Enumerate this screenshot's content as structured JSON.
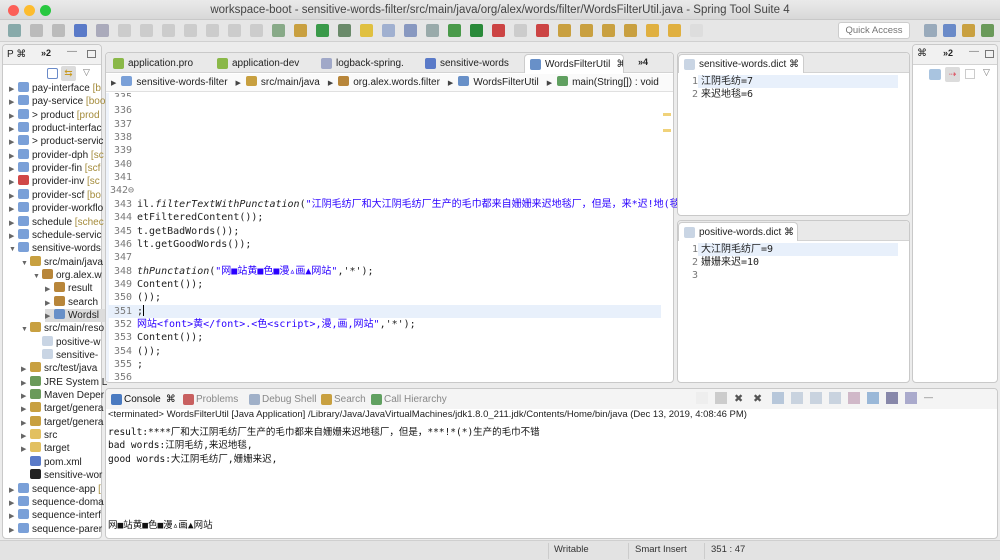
{
  "window": {
    "title": "workspace-boot - sensitive-words-filter/src/main/java/org/alex/words/filter/WordsFilterUtil.java - Spring Tool Suite 4"
  },
  "toolbar": {
    "quick_access_placeholder": "Quick Access"
  },
  "explorer": {
    "tab_label": "P",
    "overflow_label": "»2",
    "items": [
      {
        "label": "pay-interface",
        "deco": " [b",
        "indent": 0,
        "arrow": "▶",
        "icon": "project"
      },
      {
        "label": "pay-service",
        "deco": " [boo",
        "indent": 0,
        "arrow": "▶",
        "icon": "project"
      },
      {
        "label": "> product",
        "deco": " [prod",
        "indent": 0,
        "arrow": "▶",
        "icon": "project"
      },
      {
        "label": "product-interfac",
        "deco": "",
        "indent": 0,
        "arrow": "▶",
        "icon": "project"
      },
      {
        "label": "> product-servic",
        "deco": "",
        "indent": 0,
        "arrow": "▶",
        "icon": "project"
      },
      {
        "label": "provider-dph",
        "deco": " [sc",
        "indent": 0,
        "arrow": "▶",
        "icon": "project"
      },
      {
        "label": "provider-fin",
        "deco": " [scf",
        "indent": 0,
        "arrow": "▶",
        "icon": "project"
      },
      {
        "label": "provider-inv",
        "deco": " [sc",
        "indent": 0,
        "arrow": "▶",
        "icon": "project-error"
      },
      {
        "label": "provider-scf",
        "deco": " [bo",
        "indent": 0,
        "arrow": "▶",
        "icon": "project"
      },
      {
        "label": "provider-workflo",
        "deco": "",
        "indent": 0,
        "arrow": "▶",
        "icon": "project"
      },
      {
        "label": "schedule",
        "deco": " [schec",
        "indent": 0,
        "arrow": "▶",
        "icon": "project"
      },
      {
        "label": "schedule-servic",
        "deco": "",
        "indent": 0,
        "arrow": "▶",
        "icon": "project"
      },
      {
        "label": "sensitive-words",
        "deco": "",
        "indent": 0,
        "arrow": "▼",
        "icon": "project"
      },
      {
        "label": "src/main/java",
        "deco": "",
        "indent": 1,
        "arrow": "▼",
        "icon": "source-folder"
      },
      {
        "label": "org.alex.w",
        "deco": "",
        "indent": 2,
        "arrow": "▼",
        "icon": "package"
      },
      {
        "label": "result",
        "deco": "",
        "indent": 3,
        "arrow": "▶",
        "icon": "package"
      },
      {
        "label": "search",
        "deco": "",
        "indent": 3,
        "arrow": "▶",
        "icon": "package"
      },
      {
        "label": "Wordsl",
        "deco": "",
        "indent": 3,
        "arrow": "▶",
        "icon": "java-file",
        "selected": true
      },
      {
        "label": "src/main/reso",
        "deco": "",
        "indent": 1,
        "arrow": "▼",
        "icon": "source-folder"
      },
      {
        "label": "positive-w",
        "deco": "",
        "indent": 2,
        "arrow": "",
        "icon": "file"
      },
      {
        "label": "sensitive-",
        "deco": "",
        "indent": 2,
        "arrow": "",
        "icon": "file"
      },
      {
        "label": "src/test/java",
        "deco": "",
        "indent": 1,
        "arrow": "▶",
        "icon": "source-folder"
      },
      {
        "label": "JRE System L",
        "deco": "",
        "indent": 1,
        "arrow": "▶",
        "icon": "library"
      },
      {
        "label": "Maven Deper",
        "deco": "",
        "indent": 1,
        "arrow": "▶",
        "icon": "library"
      },
      {
        "label": "target/genera",
        "deco": "",
        "indent": 1,
        "arrow": "▶",
        "icon": "source-folder"
      },
      {
        "label": "target/genera",
        "deco": "",
        "indent": 1,
        "arrow": "▶",
        "icon": "source-folder"
      },
      {
        "label": "src",
        "deco": "",
        "indent": 1,
        "arrow": "▶",
        "icon": "folder"
      },
      {
        "label": "target",
        "deco": "",
        "indent": 1,
        "arrow": "▶",
        "icon": "folder"
      },
      {
        "label": "pom.xml",
        "deco": "",
        "indent": 1,
        "arrow": "",
        "icon": "maven-file"
      },
      {
        "label": "sensitive-wor",
        "deco": "",
        "indent": 1,
        "arrow": "",
        "icon": "file-black"
      },
      {
        "label": "sequence-app",
        "deco": " [",
        "indent": 0,
        "arrow": "▶",
        "icon": "project"
      },
      {
        "label": "sequence-doma",
        "deco": "",
        "indent": 0,
        "arrow": "▶",
        "icon": "project"
      },
      {
        "label": "sequence-interf",
        "deco": "",
        "indent": 0,
        "arrow": "▶",
        "icon": "project"
      },
      {
        "label": "sequence-parer",
        "deco": "",
        "indent": 0,
        "arrow": "▶",
        "icon": "project"
      }
    ]
  },
  "editor": {
    "tabs": [
      {
        "label": "application.pro",
        "icon": "spring-leaf"
      },
      {
        "label": "application-dev",
        "icon": "spring-leaf"
      },
      {
        "label": "logback-spring.",
        "icon": "xml-file"
      },
      {
        "label": "sensitive-words",
        "icon": "maven-file"
      },
      {
        "label": "WordsFilterUtil",
        "icon": "java-file",
        "active": true
      }
    ],
    "overflow_label": "»4",
    "breadcrumb": [
      "sensitive-words-filter",
      "src/main/java",
      "org.alex.words.filter",
      "WordsFilterUtil",
      "main(String[]) : void"
    ],
    "lines": [
      {
        "n": "335",
        "text": ""
      },
      {
        "n": "336",
        "text": ""
      },
      {
        "n": "337",
        "text": ""
      },
      {
        "n": "338",
        "text": ""
      },
      {
        "n": "339",
        "text": ""
      },
      {
        "n": "340",
        "text": ""
      },
      {
        "n": "341",
        "text": ""
      },
      {
        "n": "342⊖",
        "text": ""
      },
      {
        "n": "343",
        "pre": "il.",
        "method": "filterTextWithPunctation",
        "mid": "(",
        "str": "\"江阴毛纺厂和大江阴毛纺厂生产的毛巾都来自姗姗来迟地毯厂，但是，来*迟!地(毯)生",
        "post": ""
      },
      {
        "n": "344",
        "pre": "etFilteredContent());"
      },
      {
        "n": "345",
        "pre": "t.getBadWords());"
      },
      {
        "n": "346",
        "pre": "lt.getGoodWords());"
      },
      {
        "n": "347",
        "pre": ""
      },
      {
        "n": "348",
        "pre": "",
        "method": "thPunctation",
        "mid": "(",
        "str": "\"网■站黄■色■漫▵画▲网站\"",
        "post": ",'*');"
      },
      {
        "n": "349",
        "pre": "Content());"
      },
      {
        "n": "350",
        "pre": "());"
      },
      {
        "n": "351",
        "pre": ";",
        "current": true
      },
      {
        "n": "352",
        "pre": "",
        "str": "网站<font>黄</font>.<色<script>,漫,画,网站\"",
        "post": ",'*');"
      },
      {
        "n": "353",
        "pre": "Content());"
      },
      {
        "n": "354",
        "pre": "());"
      },
      {
        "n": "355",
        "pre": ";"
      },
      {
        "n": "356",
        "pre": ""
      }
    ]
  },
  "sensitive_dict": {
    "title": "sensitive-words.dict",
    "lines": [
      {
        "n": "1",
        "text": "江阴毛纺=7"
      },
      {
        "n": "2",
        "text": "来迟地毯=6"
      }
    ]
  },
  "positive_dict": {
    "title": "positive-words.dict",
    "lines": [
      {
        "n": "1",
        "text": "大江阴毛纺厂=9"
      },
      {
        "n": "2",
        "text": "姗姗来迟=10"
      },
      {
        "n": "3",
        "text": ""
      }
    ]
  },
  "outline": {
    "overflow_label": "»2"
  },
  "console": {
    "tabs": [
      {
        "label": "Console",
        "icon": "console"
      },
      {
        "label": "Problems",
        "icon": "problems"
      },
      {
        "label": "Debug Shell",
        "icon": "debug-shell"
      },
      {
        "label": "Search",
        "icon": "search"
      },
      {
        "label": "Call Hierarchy",
        "icon": "call-hierarchy"
      }
    ],
    "header": "<terminated> WordsFilterUtil [Java Application] /Library/Java/JavaVirtualMachines/jdk1.8.0_211.jdk/Contents/Home/bin/java (Dec 13, 2019, 4:08:46 PM)",
    "output": [
      "result:****厂和大江阴毛纺厂生产的毛巾都来自姗姗来迟地毯厂，但是，***!*(*)生产的毛巾不错",
      "bad words:江阴毛纺,来迟地毯,",
      "good words:大江阴毛纺厂,姗姗来迟,"
    ],
    "last_line": "网■站黄■色■漫▵画▲网站"
  },
  "status": {
    "writable": "Writable",
    "insert_mode": "Smart Insert",
    "position": "351 : 47"
  }
}
